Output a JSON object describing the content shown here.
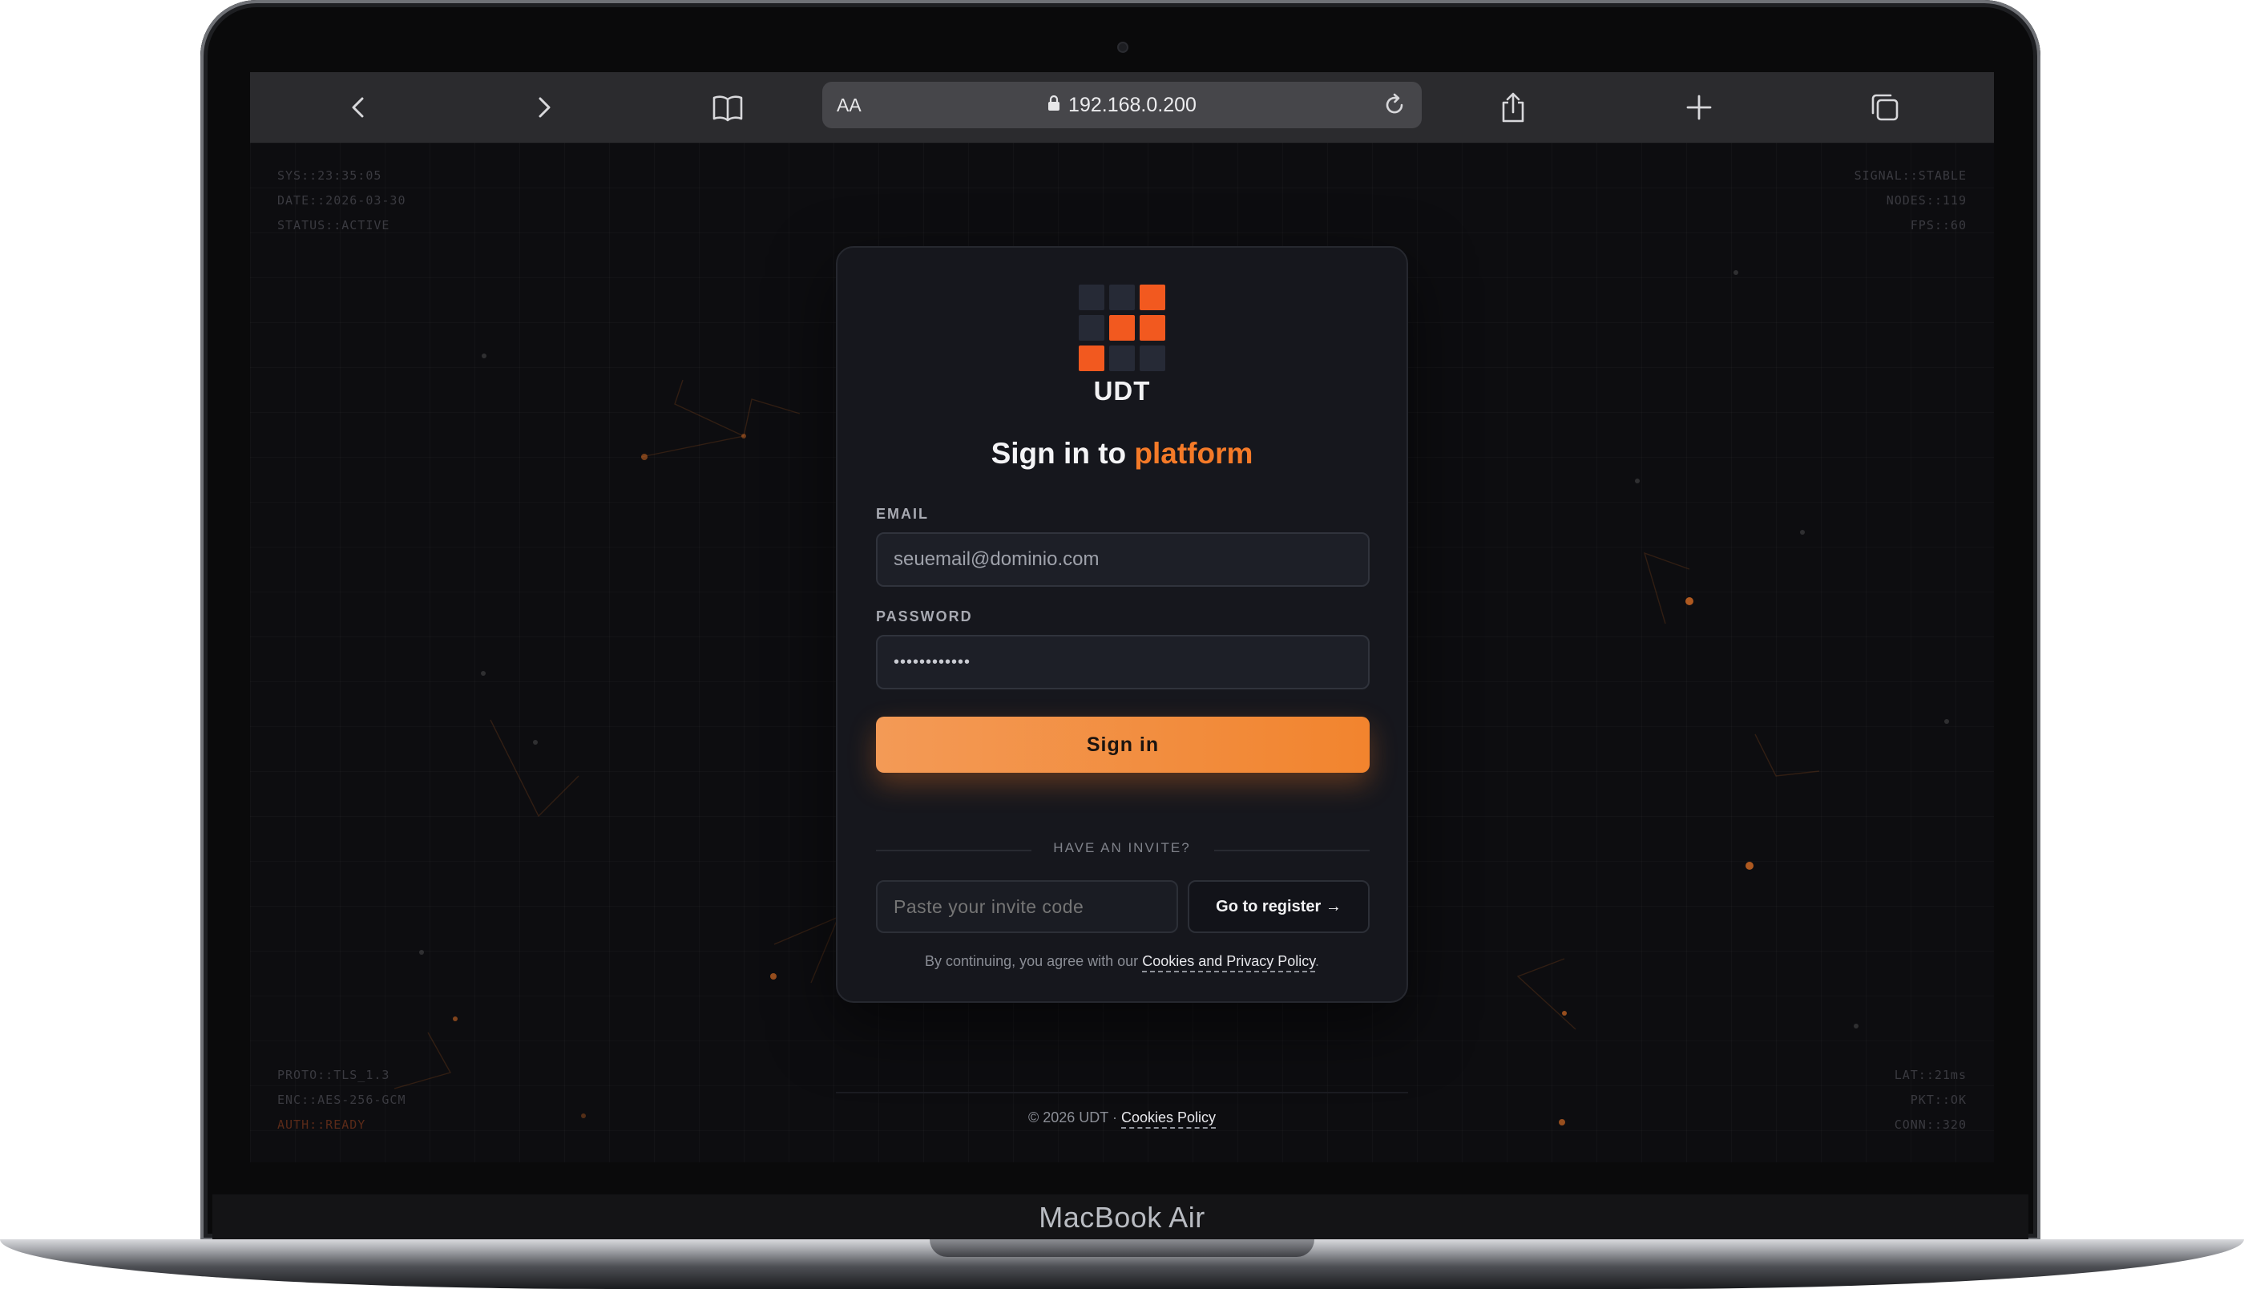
{
  "browser": {
    "aa_label": "AA",
    "url": "192.168.0.200"
  },
  "hud": {
    "top_left": [
      "SYS::23:35:05",
      "DATE::2026-03-30",
      "STATUS::ACTIVE"
    ],
    "top_right": [
      "SIGNAL::STABLE",
      "NODES::119",
      "FPS::60"
    ],
    "bottom_left": [
      "PROTO::TLS_1.3",
      "ENC::AES-256-GCM",
      "AUTH::READY"
    ],
    "bottom_right": [
      "LAT::21ms",
      "PKT::OK",
      "CONN::320"
    ]
  },
  "login": {
    "brand": "UDT",
    "heading_prefix": "Sign in to",
    "heading_accent": "platform",
    "email_label": "EMAIL",
    "email_value": "seuemail@dominio.com",
    "password_label": "PASSWORD",
    "password_value": "••••••••••••",
    "signin_label": "Sign in",
    "invite_divider": "HAVE AN INVITE?",
    "invite_placeholder": "Paste your invite code",
    "register_label": "Go to register →",
    "legal_prefix": "By continuing, you agree with our",
    "legal_link": "Cookies and Privacy Policy",
    "legal_suffix": "."
  },
  "footer": {
    "copyright": "© 2026 UDT ·",
    "cookies_link": "Cookies Policy"
  },
  "device": {
    "label": "MacBook Air"
  },
  "colors": {
    "accent": "#f47a28",
    "card": "#16171d",
    "page": "#0d0d10"
  }
}
